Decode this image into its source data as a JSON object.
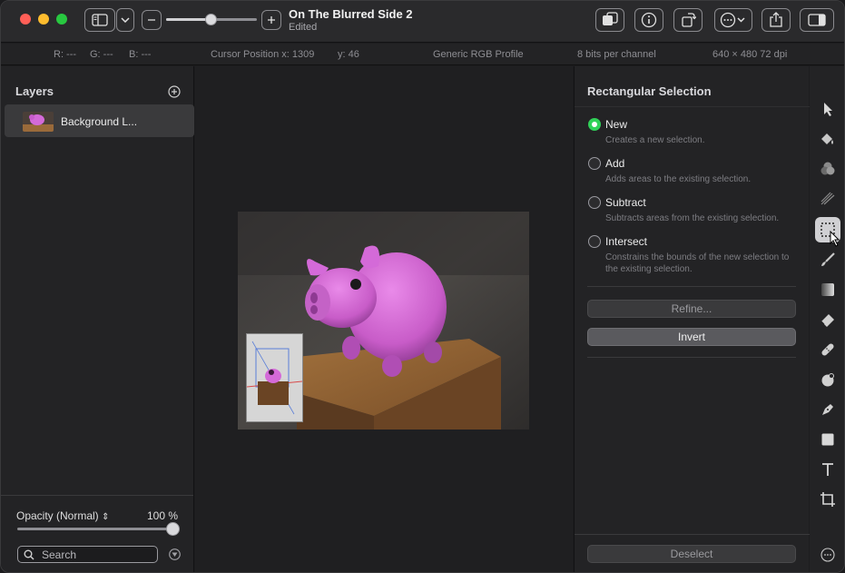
{
  "window": {
    "title": "On The Blurred Side 2",
    "subtitle": "Edited"
  },
  "toolbar": {
    "zoom_level": 0.5,
    "buttons": [
      "sidebar-toggle",
      "sidebar-menu",
      "zoom-out",
      "zoom-in",
      "arrange",
      "info",
      "rotate",
      "more",
      "share",
      "inspector-toggle"
    ]
  },
  "infobar": {
    "r": "R: ---",
    "g": "G: ---",
    "b": "B: ---",
    "cursor_x": "Cursor Position x: 1309",
    "cursor_y": "y: 46",
    "profile": "Generic RGB Profile",
    "bits": "8 bits per channel",
    "size": "640 × 480 72 dpi"
  },
  "layers": {
    "title": "Layers",
    "items": [
      {
        "name": "Background L..."
      }
    ],
    "opacity_label": "Opacity (Normal)",
    "opacity_value": "100 %",
    "opacity_level": 1.0,
    "search_placeholder": "Search"
  },
  "inspector": {
    "title": "Rectangular Selection",
    "options": [
      {
        "label": "New",
        "desc": "Creates a new selection.",
        "selected": true
      },
      {
        "label": "Add",
        "desc": "Adds areas to the existing selection.",
        "selected": false
      },
      {
        "label": "Subtract",
        "desc": "Subtracts areas from the existing selection.",
        "selected": false
      },
      {
        "label": "Intersect",
        "desc": "Constrains the bounds of the new selection to the existing selection.",
        "selected": false
      }
    ],
    "refine_label": "Refine...",
    "invert_label": "Invert",
    "deselect_label": "Deselect"
  },
  "tools": [
    "arrow-icon",
    "paint-bucket-icon",
    "color-adjust-icon",
    "retouch-icon",
    "rectangular-selection-icon",
    "brush-icon",
    "gradient-icon",
    "eraser-icon",
    "bandage-icon",
    "clone-icon",
    "pen-icon",
    "shape-icon",
    "text-icon",
    "crop-icon"
  ],
  "colors": {
    "accent_green": "#30d158",
    "pig_pink": "#d46ad8"
  }
}
